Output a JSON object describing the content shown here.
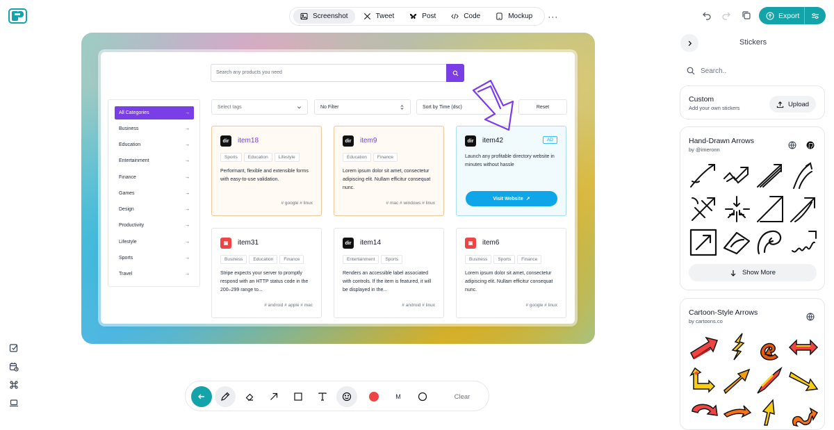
{
  "app": {
    "logo_icon": "pastel-logo-icon"
  },
  "toolbar": {
    "screenshot": "Screenshot",
    "tweet": "Tweet",
    "post": "Post",
    "code": "Code",
    "mockup": "Mockup",
    "more": "···"
  },
  "header": {
    "export_label": "Export"
  },
  "canvas": {
    "search_placeholder": "Search any products you need",
    "filters": {
      "tags": "Select tags",
      "filter": "No Filter",
      "sort": "Sort by Time (dsc)",
      "reset": "Reset"
    },
    "categories": [
      "All Categories",
      "Business",
      "Education",
      "Entertainment",
      "Finance",
      "Games",
      "Design",
      "Productivity",
      "Lifestyle",
      "Sports",
      "Travel"
    ],
    "cards": [
      {
        "title": "item18",
        "tags": [
          "Sports",
          "Education",
          "Lifestyle"
        ],
        "desc": "Performant, flexible and extensible forms with easy-to-use validation.",
        "platforms": "# google  # linux"
      },
      {
        "title": "item9",
        "tags": [
          "Education",
          "Finance"
        ],
        "desc": "Lorem ipsum dolor sit amet, consectetur adipiscing elit. Nullam efficitur consequat nunc.",
        "platforms": "# mac  # windows  # linux"
      },
      {
        "title": "item42",
        "badge": "AD",
        "desc": "Launch any profitable directory website in minutes without hassle",
        "cta": "Visit Website"
      },
      {
        "title": "item31",
        "tags": [
          "Business",
          "Education",
          "Finance"
        ],
        "desc": "Stripe expects your server to promptly respond with an HTTP status code in the 200–299 range to...",
        "platforms": "# android  # apple  # mac"
      },
      {
        "title": "item14",
        "tags": [
          "Entertainment",
          "Sports"
        ],
        "desc": "Renders an accessible label associated with controls. If the item is featured, it will be displayed in the...",
        "platforms": "# android  # linux"
      },
      {
        "title": "item6",
        "tags": [
          "Business",
          "Sports",
          "Finance"
        ],
        "desc": "Lorem ipsum dolor sit amet, consectetur adipiscing elit. Nullam efficitur consequat nunc.",
        "platforms": "# google  # linux"
      }
    ],
    "logo_text": "dir"
  },
  "drawbar": {
    "marker_label": "M",
    "clear": "Clear",
    "color": "#ef4444"
  },
  "stickers": {
    "title": "Stickers",
    "search_placeholder": "Search..",
    "custom": {
      "title": "Custom",
      "sub": "Add your own stickers",
      "upload": "Upload"
    },
    "hand_drawn": {
      "title": "Hand-Drawn Arrows",
      "author": "by @imeronn",
      "show_more": "Show More"
    },
    "cartoon": {
      "title": "Cartoon-Style Arrows",
      "author": "by cartoons.co"
    }
  },
  "colors": {
    "accent": "#14a3a8",
    "purple": "#7a3ee6",
    "ad_blue": "#0ea5e9"
  }
}
